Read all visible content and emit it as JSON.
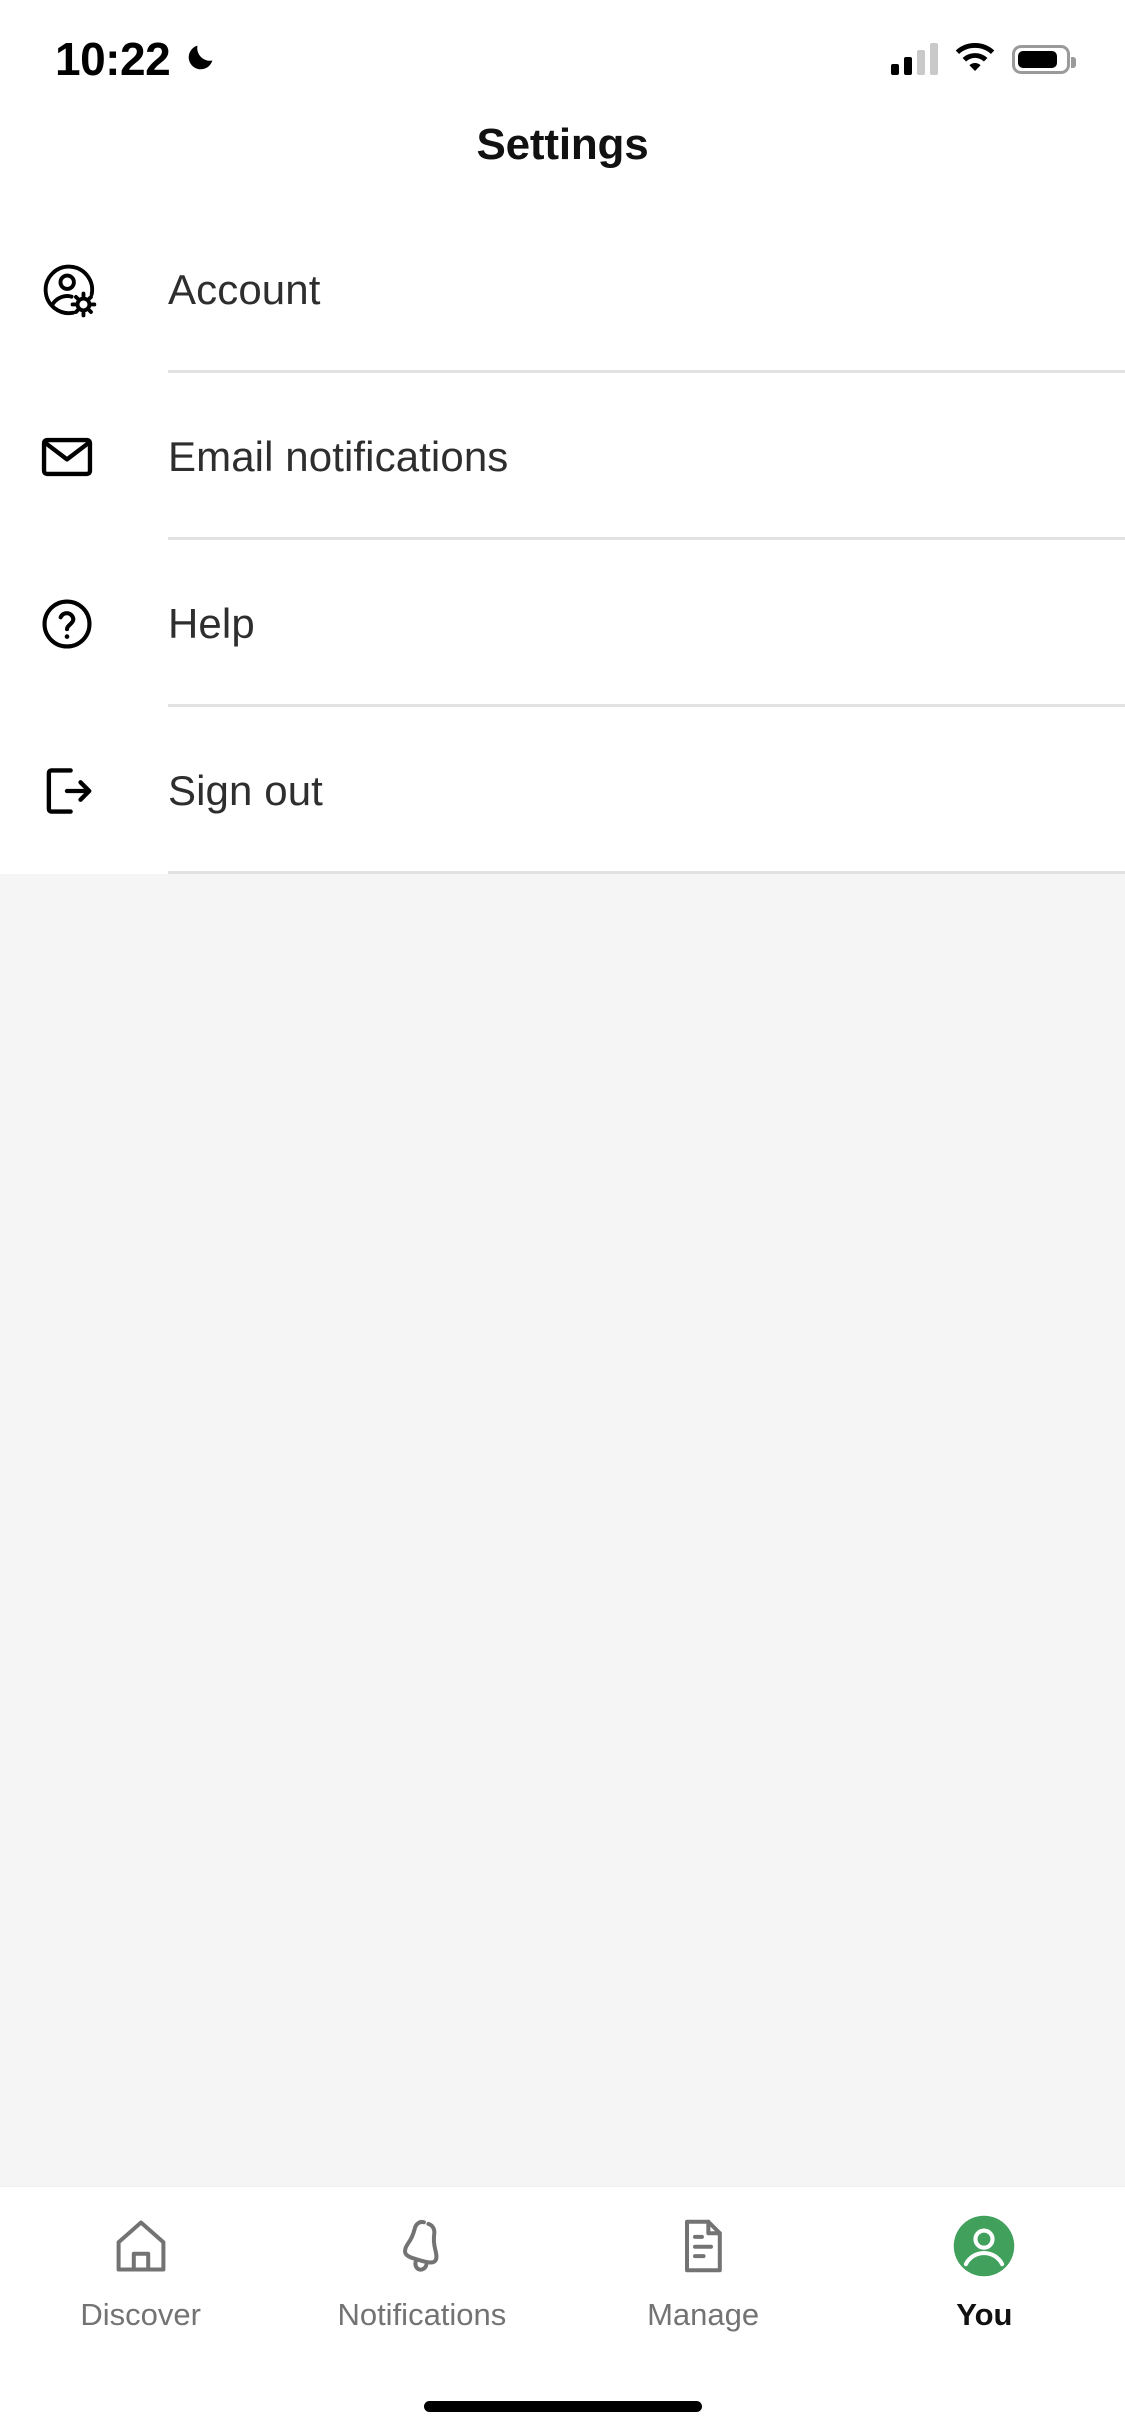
{
  "status_bar": {
    "time": "10:22",
    "dnd_icon": "crescent-moon-icon",
    "signal_icon": "cellular-signal-icon",
    "signal_bars_filled": 2,
    "signal_bars_total": 4,
    "wifi_icon": "wifi-icon",
    "battery_icon": "battery-icon",
    "battery_level_percent": 84
  },
  "header": {
    "title": "Settings"
  },
  "settings": {
    "items": [
      {
        "label": "Account",
        "icon": "account-gear-icon"
      },
      {
        "label": "Email notifications",
        "icon": "envelope-icon"
      },
      {
        "label": "Help",
        "icon": "question-circle-icon"
      },
      {
        "label": "Sign out",
        "icon": "sign-out-icon"
      }
    ]
  },
  "bottom_nav": {
    "active_index": 3,
    "items": [
      {
        "label": "Discover",
        "icon": "home-icon"
      },
      {
        "label": "Notifications",
        "icon": "bell-icon"
      },
      {
        "label": "Manage",
        "icon": "document-icon"
      },
      {
        "label": "You",
        "icon": "avatar-icon"
      }
    ]
  },
  "colors": {
    "accent_green": "#40a05c",
    "divider": "#e2e2e2",
    "page_background": "#f5f5f5",
    "surface": "#ffffff",
    "label_text": "#2e2e2e",
    "inactive_nav": "#737373"
  }
}
